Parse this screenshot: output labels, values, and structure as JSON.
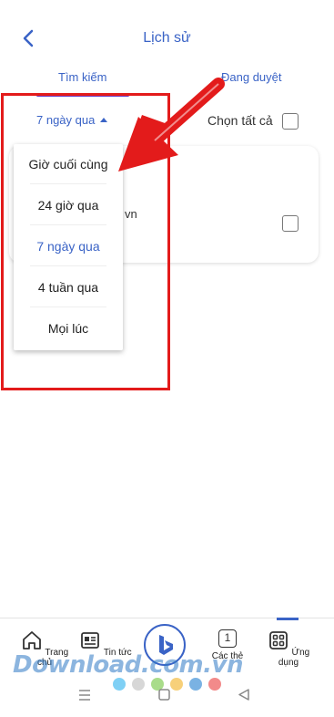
{
  "header": {
    "title": "Lịch sử"
  },
  "tabs": [
    {
      "label": "Tìm kiếm"
    },
    {
      "label": "Đang duyệt"
    }
  ],
  "filter": {
    "selected": "7 ngày qua",
    "select_all_label": "Chọn tất cả"
  },
  "dropdown": {
    "options": [
      "Giờ cuối cùng",
      "24 giờ qua",
      "7 ngày qua",
      "4 tuần qua",
      "Mọi lúc"
    ],
    "selected": "7 ngày qua"
  },
  "card": {
    "partial_text": "vn"
  },
  "bottom_nav": {
    "items": [
      {
        "label": "Trang chủ",
        "icon": "home-icon"
      },
      {
        "label": "Tin tức",
        "icon": "news-icon"
      },
      {
        "label": "",
        "icon": "bing-icon"
      },
      {
        "label": "Các thẻ",
        "icon": "tabs-icon"
      },
      {
        "label": "Ứng dụng",
        "icon": "apps-icon"
      }
    ],
    "tabs_count": "1"
  },
  "watermark": {
    "text": "Download.com.vn"
  },
  "colors": {
    "accent": "#3a63c6",
    "highlight": "#e31b1b"
  },
  "dots": [
    "#7fd0f5",
    "#d7d7d7",
    "#a9dc8a",
    "#f7d07a",
    "#7ab2e3",
    "#f28a8a"
  ]
}
